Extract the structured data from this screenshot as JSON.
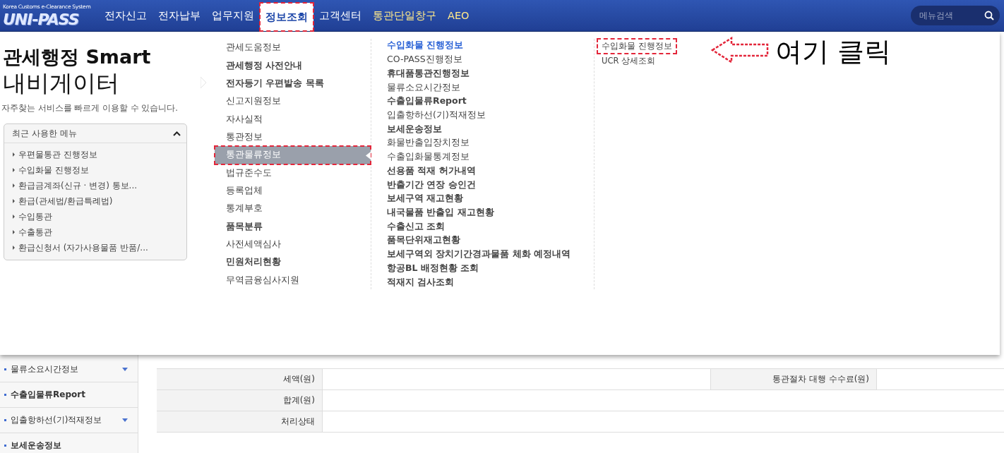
{
  "header": {
    "logo": {
      "tagline": "Korea Customs e-Clearance System",
      "text": "UNI-PASS"
    },
    "nav": [
      {
        "label": "전자신고",
        "selected": false,
        "kind": "main",
        "highlighted": false
      },
      {
        "label": "전자납부",
        "selected": false,
        "kind": "main",
        "highlighted": false
      },
      {
        "label": "업무지원",
        "selected": false,
        "kind": "main",
        "highlighted": false
      },
      {
        "label": "정보조회",
        "selected": true,
        "kind": "main",
        "highlighted": true
      },
      {
        "label": "고객센터",
        "selected": false,
        "kind": "main",
        "highlighted": false
      },
      {
        "label": "통관단일창구",
        "selected": false,
        "kind": "extra",
        "highlighted": false
      },
      {
        "label": "AEO",
        "selected": false,
        "kind": "extra",
        "highlighted": false
      }
    ],
    "search": {
      "placeholder": "메뉴검색"
    }
  },
  "navigator": {
    "title_bold": "관세행정 Smart",
    "title": "내비게이터",
    "description": "자주찾는 서비스를 빠르게 이용할 수 있습니다.",
    "recent": {
      "title": "최근 사용한 메뉴",
      "expanded": true,
      "items": [
        "우편물통관 진행정보",
        "수입화물 진행정보",
        "환급금계좌(신규 · 변경) 통보...",
        "환급(관세법/환급특례법)",
        "수입통관",
        "수출통관",
        "환급신청서 (자가사용물품 반품/..."
      ]
    }
  },
  "menu_columns": [
    {
      "items": [
        {
          "label": "관세도움정보",
          "bold": false,
          "selected": false,
          "highlighted": false
        },
        {
          "label": "관세행정 사전안내",
          "bold": true,
          "selected": false,
          "highlighted": false
        },
        {
          "label": "전자등기 우편발송 목록",
          "bold": true,
          "selected": false,
          "highlighted": false
        },
        {
          "label": "신고지원정보",
          "bold": false,
          "selected": false,
          "highlighted": false
        },
        {
          "label": "자사실적",
          "bold": false,
          "selected": false,
          "highlighted": false
        },
        {
          "label": "통관정보",
          "bold": false,
          "selected": false,
          "highlighted": false
        },
        {
          "label": "통관물류정보",
          "bold": false,
          "selected": true,
          "highlighted": true
        },
        {
          "label": "법규준수도",
          "bold": false,
          "selected": false,
          "highlighted": false
        },
        {
          "label": "등록업체",
          "bold": false,
          "selected": false,
          "highlighted": false
        },
        {
          "label": "통계부호",
          "bold": false,
          "selected": false,
          "highlighted": false
        },
        {
          "label": "품목분류",
          "bold": true,
          "selected": false,
          "highlighted": false
        },
        {
          "label": "사전세액심사",
          "bold": false,
          "selected": false,
          "highlighted": false
        },
        {
          "label": "민원처리현황",
          "bold": true,
          "selected": false,
          "highlighted": false
        },
        {
          "label": "무역금융심사지원",
          "bold": false,
          "selected": false,
          "highlighted": false
        }
      ]
    },
    {
      "items": [
        {
          "label": "수입화물 진행정보",
          "bold": true,
          "selected": true,
          "highlighted": false
        },
        {
          "label": "CO-PASS진행정보",
          "bold": false,
          "selected": false,
          "highlighted": false
        },
        {
          "label": "휴대품통관진행정보",
          "bold": true,
          "selected": false,
          "highlighted": false
        },
        {
          "label": "물류소요시간정보",
          "bold": false,
          "selected": false,
          "highlighted": false
        },
        {
          "label": "수출입물류Report",
          "bold": true,
          "selected": false,
          "highlighted": false
        },
        {
          "label": "입출항하선(기)적재정보",
          "bold": false,
          "selected": false,
          "highlighted": false
        },
        {
          "label": "보세운송정보",
          "bold": true,
          "selected": false,
          "highlighted": false
        },
        {
          "label": "화물반출입장치정보",
          "bold": false,
          "selected": false,
          "highlighted": false
        },
        {
          "label": "수출입화물통계정보",
          "bold": false,
          "selected": false,
          "highlighted": false
        },
        {
          "label": "선용품 적재 허가내역",
          "bold": true,
          "selected": false,
          "highlighted": false
        },
        {
          "label": "반출기간 연장 승인건",
          "bold": true,
          "selected": false,
          "highlighted": false
        },
        {
          "label": "보세구역 재고현황",
          "bold": true,
          "selected": false,
          "highlighted": false
        },
        {
          "label": "내국물품 반출입 재고현황",
          "bold": true,
          "selected": false,
          "highlighted": false
        },
        {
          "label": "수출신고 조회",
          "bold": true,
          "selected": false,
          "highlighted": false
        },
        {
          "label": "품목단위재고현황",
          "bold": true,
          "selected": false,
          "highlighted": false
        },
        {
          "label": "보세구역외 장치기간경과물품 체화 예정내역",
          "bold": true,
          "selected": false,
          "highlighted": false
        },
        {
          "label": "항공BL 배정현황 조회",
          "bold": true,
          "selected": false,
          "highlighted": false
        },
        {
          "label": "적재지 검사조회",
          "bold": true,
          "selected": false,
          "highlighted": false
        }
      ]
    },
    {
      "items": [
        {
          "label": "수입화물 진행정보",
          "bold": false,
          "selected": false,
          "highlighted": true
        },
        {
          "label": "UCR 상세조회",
          "bold": false,
          "selected": false,
          "highlighted": false
        }
      ]
    }
  ],
  "annotation": {
    "text": "여기 클릭"
  },
  "sidebar": [
    {
      "label": "물류소요시간정보",
      "bold": false,
      "caret": true
    },
    {
      "label": "수출입물류Report",
      "bold": true,
      "caret": false
    },
    {
      "label": "입출항하선(기)적재정보",
      "bold": false,
      "caret": true
    },
    {
      "label": "보세운송정보",
      "bold": true,
      "caret": false
    }
  ],
  "table": {
    "rows": [
      {
        "label": "세액(원)",
        "label_2": "통관절차 대행 수수료(원)"
      },
      {
        "label": "합계(원)"
      },
      {
        "label": "처리상태"
      }
    ]
  }
}
